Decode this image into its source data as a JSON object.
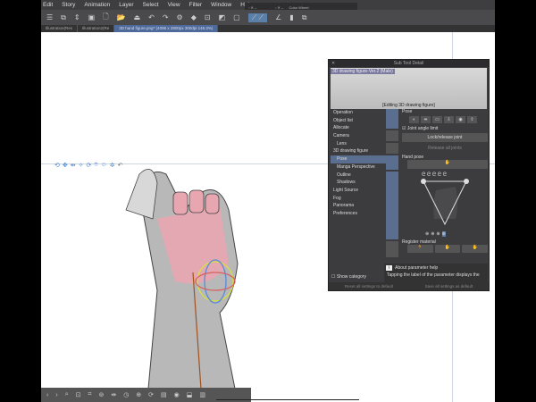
{
  "menu": [
    "Edit",
    "Story",
    "Animation",
    "Layer",
    "Select",
    "View",
    "Filter",
    "Window",
    "Help"
  ],
  "color_wheel_title": "Color Wheel",
  "tabs": [
    "Illustration(Res",
    "Illustration2(Re",
    "3D hand figure.png* (4096 x 2800px 300dpi 146.3%)"
  ],
  "panel": {
    "title": "Sub Tool Detail",
    "preview_label": "3D drawing figure-Ver.2 (Male)",
    "preview_caption": "[Editing 3D drawing figure]",
    "categories": [
      {
        "label": "Operation",
        "sub": false
      },
      {
        "label": "Object list",
        "sub": false
      },
      {
        "label": "Allocate",
        "sub": false
      },
      {
        "label": "Camera",
        "sub": false
      },
      {
        "label": "Lens",
        "sub": true
      },
      {
        "label": "3D drawing figure",
        "sub": false
      },
      {
        "label": "Pose",
        "sub": true,
        "active": true
      },
      {
        "label": "Manga Perspective",
        "sub": true
      },
      {
        "label": "Outline",
        "sub": true
      },
      {
        "label": "Shadows",
        "sub": true
      },
      {
        "label": "Light Source",
        "sub": false
      },
      {
        "label": "Fog",
        "sub": false
      },
      {
        "label": "Panorama",
        "sub": false
      },
      {
        "label": "Preferences",
        "sub": false
      }
    ],
    "pose_label": "Pose",
    "joint_angle_limit": "Joint angle limit",
    "joint_angle_checked": true,
    "lock_release": "Lock/release joint",
    "release_all": "Release all joints",
    "hand_pose": "Hand pose",
    "register_material": "Register material",
    "help_title": "About parameter help",
    "help_text": "Tapping the label of the parameter displays the",
    "show_category": "Show category",
    "reset_all": "Reset all settings to default",
    "save_all": "Save all settings as default"
  }
}
